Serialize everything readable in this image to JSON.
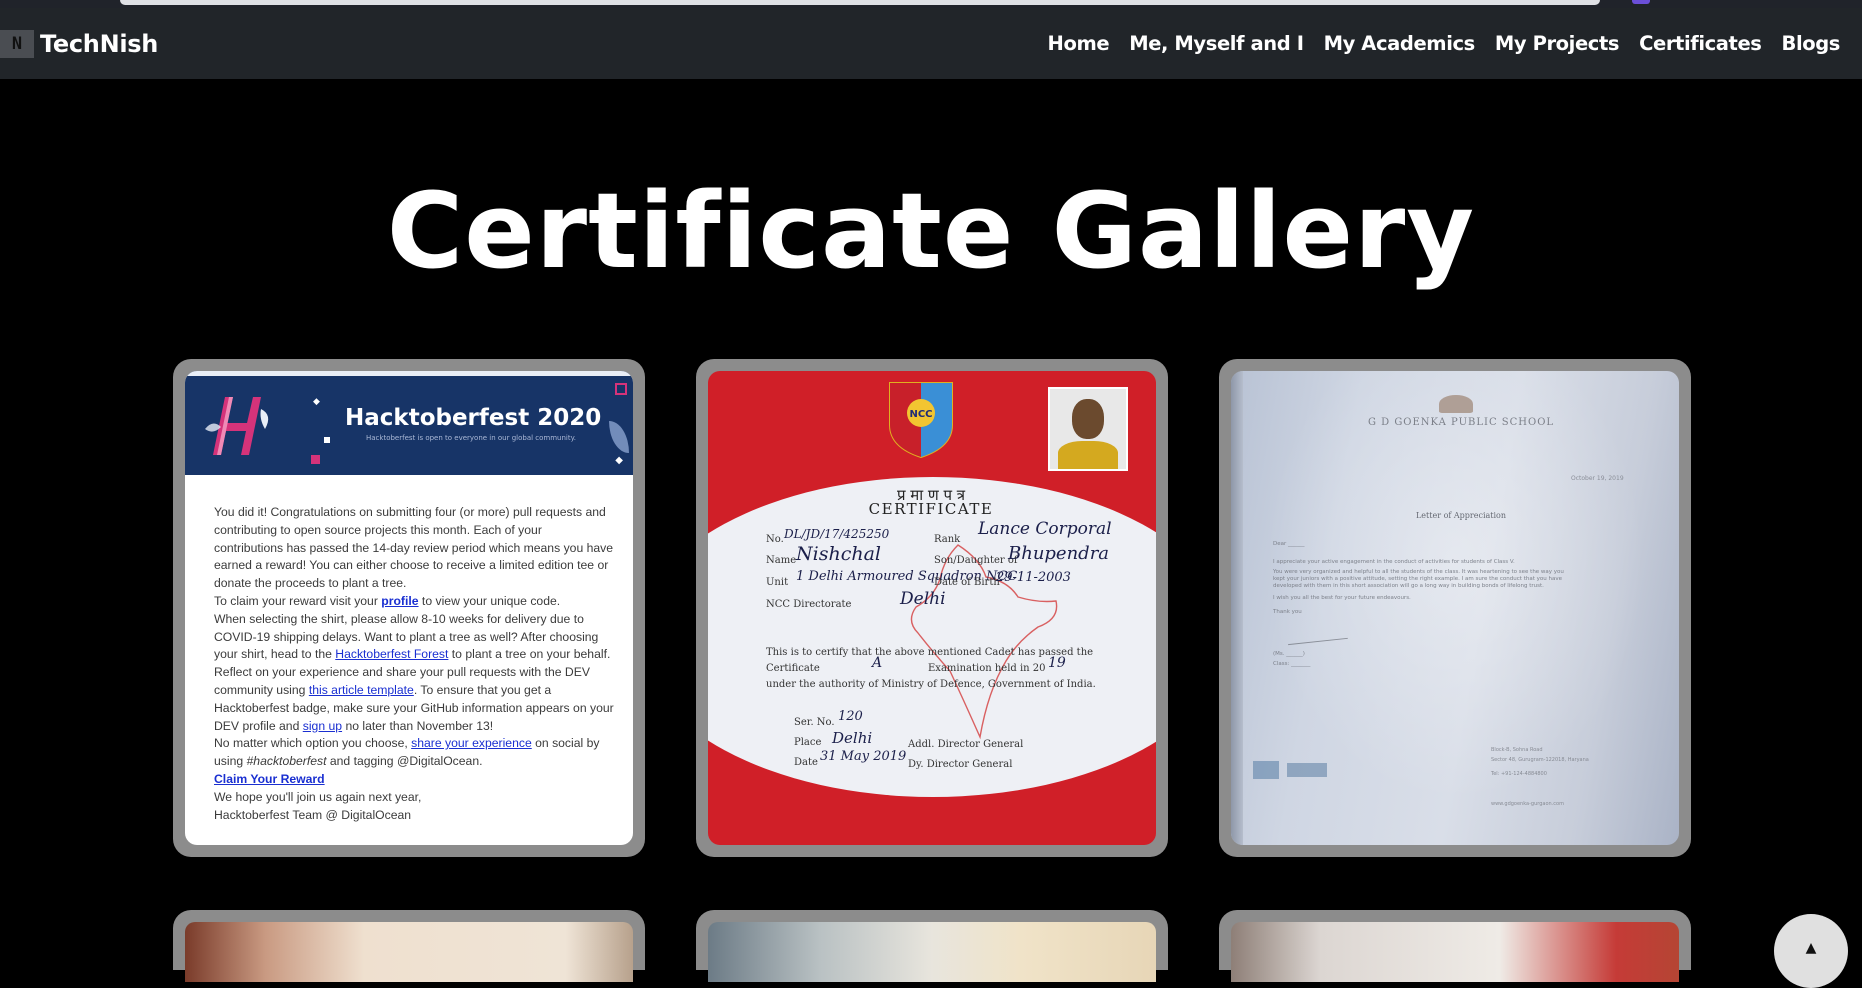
{
  "navbar": {
    "brand_logo": "N",
    "brand_name": "TechNish",
    "links": [
      "Home",
      "Me, Myself and I",
      "My Academics",
      "My Projects",
      "Certificates",
      "Blogs"
    ]
  },
  "page": {
    "title": "Certificate Gallery"
  },
  "certificates": {
    "hacktoberfest": {
      "banner_title": "Hacktoberfest 2020",
      "banner_sub": "Hacktoberfest is open to everyone in our global community.",
      "p1": "You did it! Congratulations on submitting four (or more) pull requests and contributing to open source projects this month. Each of your contributions has passed the 14-day review period which means you have earned a reward! You can either choose to receive a limited edition tee or donate the proceeds to plant a tree.",
      "p2_a": "To claim your reward visit your ",
      "p2_link": "profile",
      "p2_b": " to view your unique code.",
      "p3_a": "When selecting the shirt, please allow 8-10 weeks for delivery due to COVID-19 shipping delays. Want to plant a tree as well? After choosing your shirt, head to the ",
      "p3_link": "Hacktoberfest Forest",
      "p3_b": " to plant a tree on your behalf.",
      "p4_a": "Reflect on your experience and share your pull requests with the DEV community using ",
      "p4_link1": "this article template",
      "p4_b": ". To ensure that you get a Hacktoberfest badge, make sure your GitHub information appears on your DEV profile and ",
      "p4_link2": "sign up",
      "p4_c": " no later than November 13!",
      "p5_a": "No matter which option you choose, ",
      "p5_link": "share your experience",
      "p5_b": " on social by using ",
      "p5_hashtag": "#hacktoberfest",
      "p5_c": " and tagging @DigitalOcean.",
      "claim": "Claim Your Reward",
      "p6": "We hope you'll join us again next year,",
      "p7": "Hacktoberfest Team @ DigitalOcean"
    },
    "ncc": {
      "title_hi": "प्र मा ण प त्र",
      "title_en": "CERTIFICATE",
      "no": "DL/JD/17/425250",
      "rank": "Lance Corporal",
      "name": "Nishchal",
      "father": "Bhupendra",
      "unit": "1 Delhi Armoured Squadron NCC",
      "dob": "29-11-2003",
      "directorate": "Delhi",
      "grade": "A",
      "exam_year": "19",
      "serial": "120",
      "place": "Delhi",
      "date": "31 May 2019",
      "line1": "This is to certify that the above mentioned Cadet has passed the",
      "line2": "Certificate",
      "line3": "Examination held in 20",
      "line4": "under the authority of Ministry of Defence, Government of India."
    },
    "goenka": {
      "school": "G D GOENKA PUBLIC SCHOOL",
      "heading": "Letter of Appreciation"
    }
  },
  "scroll_top": {
    "icon": "chevron-up-icon",
    "glyph": "▲"
  },
  "colors": {
    "navbar_bg": "#212529",
    "page_bg": "#000000",
    "card_frame": "#8c8c8c",
    "link": "#1a2fd1",
    "hacktoberfest_banner": "#173467",
    "ncc_red": "#d01f28"
  }
}
